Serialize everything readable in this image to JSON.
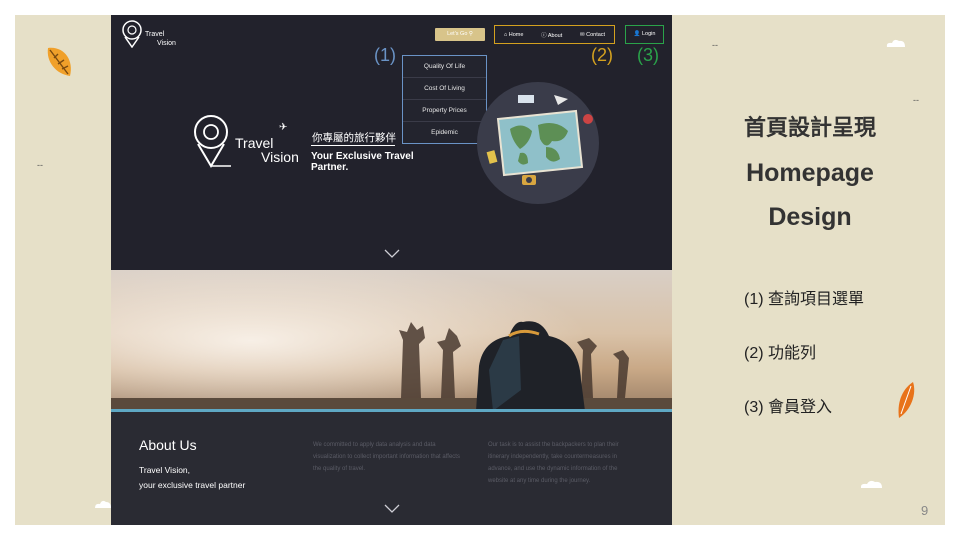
{
  "site": {
    "logo_small": {
      "line1": "Travel",
      "line2": "Vision"
    },
    "nav": {
      "lets_go": "Let's Go",
      "home": "Home",
      "about": "About",
      "contact": "Contact",
      "login": "Login"
    },
    "annotations": {
      "a1": "(1)",
      "a2": "(2)",
      "a3": "(3)"
    },
    "dropdown": [
      "Quality Of Life",
      "Cost Of Living",
      "Property Prices",
      "Epidemic"
    ],
    "hero": {
      "logo_line1": "Travel",
      "logo_line2": "Vision",
      "slogan_cn": "你專屬的旅行夥伴",
      "slogan_en": "Your Exclusive Travel Partner."
    },
    "about": {
      "title": "About Us",
      "sub_line1": "Travel Vision,",
      "sub_line2": "your exclusive travel partner",
      "col1": "We committed to apply data analysis and data visualization to collect important information that affects the quality of travel.",
      "col2": "Our task is to assist the backpackers to plan their itinerary independently, take countermeasures in advance, and use the dynamic information of the website at any time during the journey."
    }
  },
  "slide": {
    "title_cn": "首頁設計呈現",
    "title_en1": "Homepage",
    "title_en2": "Design",
    "items": [
      "(1) 查詢項目選單",
      "(2) 功能列",
      "(3) 會員登入"
    ],
    "page_number": "9"
  },
  "colors": {
    "slide_bg": "#e6e0c8",
    "site_bg": "#22222c",
    "annot1": "#6a93c6",
    "annot2": "#d4a11f",
    "annot3": "#2aa34a",
    "leaf_orange": "#e8891a"
  }
}
